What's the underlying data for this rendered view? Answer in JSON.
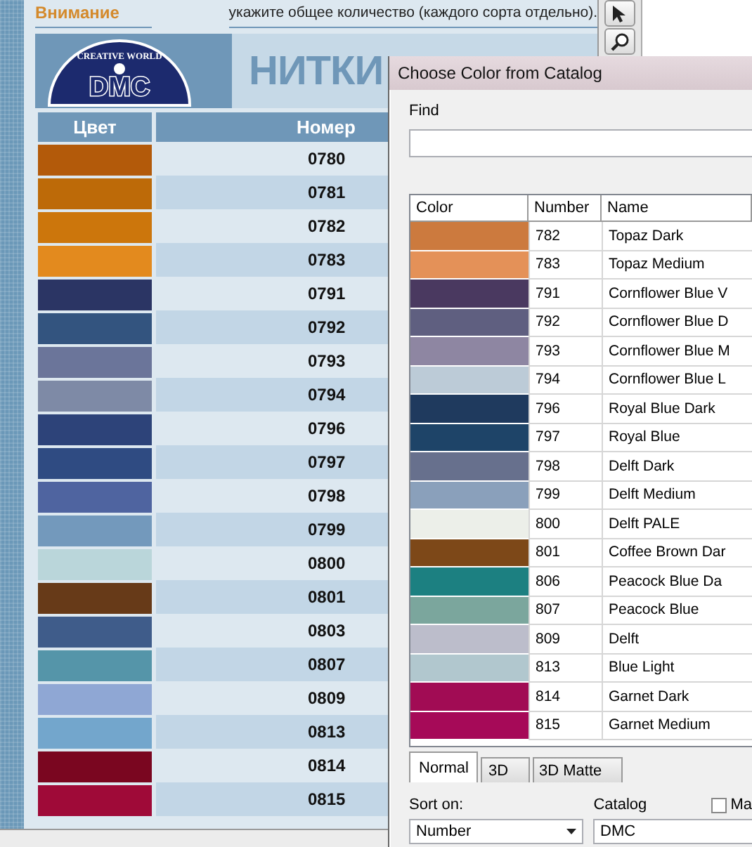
{
  "page": {
    "notice_title": "Внимание",
    "notice_text": "укажите общее количество (каждого сорта отдельно).",
    "logo": {
      "tagline": "CREATIVE WORLD",
      "brand": "DMC"
    },
    "heading": "НИТКИ",
    "columns": [
      "Цвет",
      "Номер"
    ],
    "threads": [
      {
        "number": "0780",
        "color": "#b35a0a"
      },
      {
        "number": "0781",
        "color": "#bd6a08"
      },
      {
        "number": "0782",
        "color": "#cc760c"
      },
      {
        "number": "0783",
        "color": "#e38a1e"
      },
      {
        "number": "0791",
        "color": "#2b3564"
      },
      {
        "number": "0792",
        "color": "#33547f"
      },
      {
        "number": "0793",
        "color": "#6b759a"
      },
      {
        "number": "0794",
        "color": "#7e8aa6"
      },
      {
        "number": "0796",
        "color": "#2d4379"
      },
      {
        "number": "0797",
        "color": "#2f4b82"
      },
      {
        "number": "0798",
        "color": "#4f64a0"
      },
      {
        "number": "0799",
        "color": "#7399bc"
      },
      {
        "number": "0800",
        "color": "#bad6da"
      },
      {
        "number": "0801",
        "color": "#673a18"
      },
      {
        "number": "0803",
        "color": "#3f5c8a"
      },
      {
        "number": "0807",
        "color": "#5595a9"
      },
      {
        "number": "0809",
        "color": "#8fa7d4"
      },
      {
        "number": "0813",
        "color": "#73a6cc"
      },
      {
        "number": "0814",
        "color": "#7a0620"
      },
      {
        "number": "0815",
        "color": "#9f0a38"
      }
    ]
  },
  "dialog": {
    "title": "Choose Color from Catalog",
    "find": {
      "label": "Find"
    },
    "columns": [
      "Color",
      "Number",
      "Name"
    ],
    "rows": [
      {
        "color": "#cc7a3e",
        "number": "782",
        "name": "Topaz Dark"
      },
      {
        "color": "#e49158",
        "number": "783",
        "name": "Topaz Medium"
      },
      {
        "color": "#4a3960",
        "number": "791",
        "name": "Cornflower Blue V"
      },
      {
        "color": "#5f5f80",
        "number": "792",
        "name": "Cornflower Blue D"
      },
      {
        "color": "#8e86a2",
        "number": "793",
        "name": "Cornflower Blue M"
      },
      {
        "color": "#bccbd7",
        "number": "794",
        "name": "Cornflower Blue L"
      },
      {
        "color": "#1f3a5e",
        "number": "796",
        "name": "Royal Blue Dark"
      },
      {
        "color": "#1e4468",
        "number": "797",
        "name": "Royal Blue"
      },
      {
        "color": "#67708d",
        "number": "798",
        "name": "Delft Dark"
      },
      {
        "color": "#8aa0bb",
        "number": "799",
        "name": "Delft Medium"
      },
      {
        "color": "#ecefe9",
        "number": "800",
        "name": "Delft PALE"
      },
      {
        "color": "#7d4818",
        "number": "801",
        "name": "Coffee Brown Dar"
      },
      {
        "color": "#1c8081",
        "number": "806",
        "name": "Peacock Blue Da"
      },
      {
        "color": "#7ba69d",
        "number": "807",
        "name": "Peacock Blue"
      },
      {
        "color": "#bcbdcb",
        "number": "809",
        "name": "Delft"
      },
      {
        "color": "#b1c7ce",
        "number": "813",
        "name": "Blue Light"
      },
      {
        "color": "#a10c54",
        "number": "814",
        "name": "Garnet Dark"
      },
      {
        "color": "#a60a58",
        "number": "815",
        "name": "Garnet Medium"
      }
    ],
    "tabs": [
      {
        "label": "Normal",
        "selected": true
      },
      {
        "label": "3D",
        "selected": false
      },
      {
        "label": "3D Matte",
        "selected": false
      }
    ],
    "sort": {
      "label": "Sort on:",
      "value": "Number"
    },
    "catalog": {
      "label": "Catalog",
      "value": "DMC"
    },
    "match": {
      "label": "Ma",
      "checked": false
    }
  }
}
